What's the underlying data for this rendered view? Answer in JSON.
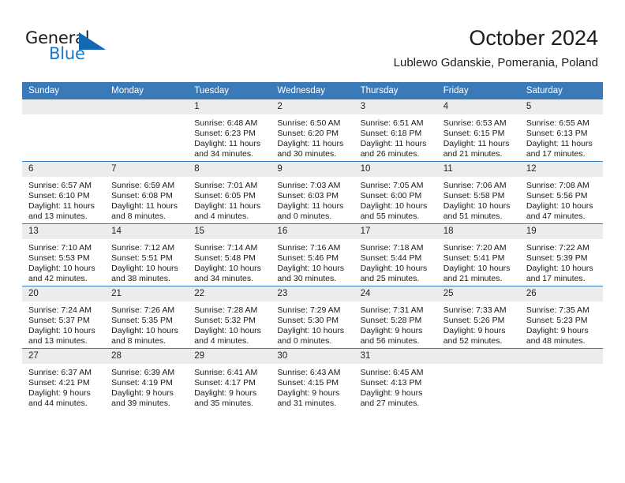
{
  "brand": {
    "name_part1": "General",
    "name_part2": "Blue",
    "logo_icon": "triangle-logo-icon",
    "accent_color": "#1268b3"
  },
  "header": {
    "title": "October 2024",
    "subtitle": "Lublewo Gdanskie, Pomerania, Poland"
  },
  "theme": {
    "header_blue": "#3a7ab8",
    "daynum_band": "#ececec",
    "text": "#1a1a1a"
  },
  "weekday_headers": [
    "Sunday",
    "Monday",
    "Tuesday",
    "Wednesday",
    "Thursday",
    "Friday",
    "Saturday"
  ],
  "weeks": [
    {
      "days": [
        {
          "day": "",
          "sunrise": "",
          "sunset": "",
          "daylight_line1": "",
          "daylight_line2": ""
        },
        {
          "day": "",
          "sunrise": "",
          "sunset": "",
          "daylight_line1": "",
          "daylight_line2": ""
        },
        {
          "day": "1",
          "sunrise": "Sunrise: 6:48 AM",
          "sunset": "Sunset: 6:23 PM",
          "daylight_line1": "Daylight: 11 hours",
          "daylight_line2": "and 34 minutes."
        },
        {
          "day": "2",
          "sunrise": "Sunrise: 6:50 AM",
          "sunset": "Sunset: 6:20 PM",
          "daylight_line1": "Daylight: 11 hours",
          "daylight_line2": "and 30 minutes."
        },
        {
          "day": "3",
          "sunrise": "Sunrise: 6:51 AM",
          "sunset": "Sunset: 6:18 PM",
          "daylight_line1": "Daylight: 11 hours",
          "daylight_line2": "and 26 minutes."
        },
        {
          "day": "4",
          "sunrise": "Sunrise: 6:53 AM",
          "sunset": "Sunset: 6:15 PM",
          "daylight_line1": "Daylight: 11 hours",
          "daylight_line2": "and 21 minutes."
        },
        {
          "day": "5",
          "sunrise": "Sunrise: 6:55 AM",
          "sunset": "Sunset: 6:13 PM",
          "daylight_line1": "Daylight: 11 hours",
          "daylight_line2": "and 17 minutes."
        }
      ]
    },
    {
      "days": [
        {
          "day": "6",
          "sunrise": "Sunrise: 6:57 AM",
          "sunset": "Sunset: 6:10 PM",
          "daylight_line1": "Daylight: 11 hours",
          "daylight_line2": "and 13 minutes."
        },
        {
          "day": "7",
          "sunrise": "Sunrise: 6:59 AM",
          "sunset": "Sunset: 6:08 PM",
          "daylight_line1": "Daylight: 11 hours",
          "daylight_line2": "and 8 minutes."
        },
        {
          "day": "8",
          "sunrise": "Sunrise: 7:01 AM",
          "sunset": "Sunset: 6:05 PM",
          "daylight_line1": "Daylight: 11 hours",
          "daylight_line2": "and 4 minutes."
        },
        {
          "day": "9",
          "sunrise": "Sunrise: 7:03 AM",
          "sunset": "Sunset: 6:03 PM",
          "daylight_line1": "Daylight: 11 hours",
          "daylight_line2": "and 0 minutes."
        },
        {
          "day": "10",
          "sunrise": "Sunrise: 7:05 AM",
          "sunset": "Sunset: 6:00 PM",
          "daylight_line1": "Daylight: 10 hours",
          "daylight_line2": "and 55 minutes."
        },
        {
          "day": "11",
          "sunrise": "Sunrise: 7:06 AM",
          "sunset": "Sunset: 5:58 PM",
          "daylight_line1": "Daylight: 10 hours",
          "daylight_line2": "and 51 minutes."
        },
        {
          "day": "12",
          "sunrise": "Sunrise: 7:08 AM",
          "sunset": "Sunset: 5:56 PM",
          "daylight_line1": "Daylight: 10 hours",
          "daylight_line2": "and 47 minutes."
        }
      ]
    },
    {
      "days": [
        {
          "day": "13",
          "sunrise": "Sunrise: 7:10 AM",
          "sunset": "Sunset: 5:53 PM",
          "daylight_line1": "Daylight: 10 hours",
          "daylight_line2": "and 42 minutes."
        },
        {
          "day": "14",
          "sunrise": "Sunrise: 7:12 AM",
          "sunset": "Sunset: 5:51 PM",
          "daylight_line1": "Daylight: 10 hours",
          "daylight_line2": "and 38 minutes."
        },
        {
          "day": "15",
          "sunrise": "Sunrise: 7:14 AM",
          "sunset": "Sunset: 5:48 PM",
          "daylight_line1": "Daylight: 10 hours",
          "daylight_line2": "and 34 minutes."
        },
        {
          "day": "16",
          "sunrise": "Sunrise: 7:16 AM",
          "sunset": "Sunset: 5:46 PM",
          "daylight_line1": "Daylight: 10 hours",
          "daylight_line2": "and 30 minutes."
        },
        {
          "day": "17",
          "sunrise": "Sunrise: 7:18 AM",
          "sunset": "Sunset: 5:44 PM",
          "daylight_line1": "Daylight: 10 hours",
          "daylight_line2": "and 25 minutes."
        },
        {
          "day": "18",
          "sunrise": "Sunrise: 7:20 AM",
          "sunset": "Sunset: 5:41 PM",
          "daylight_line1": "Daylight: 10 hours",
          "daylight_line2": "and 21 minutes."
        },
        {
          "day": "19",
          "sunrise": "Sunrise: 7:22 AM",
          "sunset": "Sunset: 5:39 PM",
          "daylight_line1": "Daylight: 10 hours",
          "daylight_line2": "and 17 minutes."
        }
      ]
    },
    {
      "days": [
        {
          "day": "20",
          "sunrise": "Sunrise: 7:24 AM",
          "sunset": "Sunset: 5:37 PM",
          "daylight_line1": "Daylight: 10 hours",
          "daylight_line2": "and 13 minutes."
        },
        {
          "day": "21",
          "sunrise": "Sunrise: 7:26 AM",
          "sunset": "Sunset: 5:35 PM",
          "daylight_line1": "Daylight: 10 hours",
          "daylight_line2": "and 8 minutes."
        },
        {
          "day": "22",
          "sunrise": "Sunrise: 7:28 AM",
          "sunset": "Sunset: 5:32 PM",
          "daylight_line1": "Daylight: 10 hours",
          "daylight_line2": "and 4 minutes."
        },
        {
          "day": "23",
          "sunrise": "Sunrise: 7:29 AM",
          "sunset": "Sunset: 5:30 PM",
          "daylight_line1": "Daylight: 10 hours",
          "daylight_line2": "and 0 minutes."
        },
        {
          "day": "24",
          "sunrise": "Sunrise: 7:31 AM",
          "sunset": "Sunset: 5:28 PM",
          "daylight_line1": "Daylight: 9 hours",
          "daylight_line2": "and 56 minutes."
        },
        {
          "day": "25",
          "sunrise": "Sunrise: 7:33 AM",
          "sunset": "Sunset: 5:26 PM",
          "daylight_line1": "Daylight: 9 hours",
          "daylight_line2": "and 52 minutes."
        },
        {
          "day": "26",
          "sunrise": "Sunrise: 7:35 AM",
          "sunset": "Sunset: 5:23 PM",
          "daylight_line1": "Daylight: 9 hours",
          "daylight_line2": "and 48 minutes."
        }
      ]
    },
    {
      "days": [
        {
          "day": "27",
          "sunrise": "Sunrise: 6:37 AM",
          "sunset": "Sunset: 4:21 PM",
          "daylight_line1": "Daylight: 9 hours",
          "daylight_line2": "and 44 minutes."
        },
        {
          "day": "28",
          "sunrise": "Sunrise: 6:39 AM",
          "sunset": "Sunset: 4:19 PM",
          "daylight_line1": "Daylight: 9 hours",
          "daylight_line2": "and 39 minutes."
        },
        {
          "day": "29",
          "sunrise": "Sunrise: 6:41 AM",
          "sunset": "Sunset: 4:17 PM",
          "daylight_line1": "Daylight: 9 hours",
          "daylight_line2": "and 35 minutes."
        },
        {
          "day": "30",
          "sunrise": "Sunrise: 6:43 AM",
          "sunset": "Sunset: 4:15 PM",
          "daylight_line1": "Daylight: 9 hours",
          "daylight_line2": "and 31 minutes."
        },
        {
          "day": "31",
          "sunrise": "Sunrise: 6:45 AM",
          "sunset": "Sunset: 4:13 PM",
          "daylight_line1": "Daylight: 9 hours",
          "daylight_line2": "and 27 minutes."
        },
        {
          "day": "",
          "sunrise": "",
          "sunset": "",
          "daylight_line1": "",
          "daylight_line2": ""
        },
        {
          "day": "",
          "sunrise": "",
          "sunset": "",
          "daylight_line1": "",
          "daylight_line2": ""
        }
      ]
    }
  ]
}
